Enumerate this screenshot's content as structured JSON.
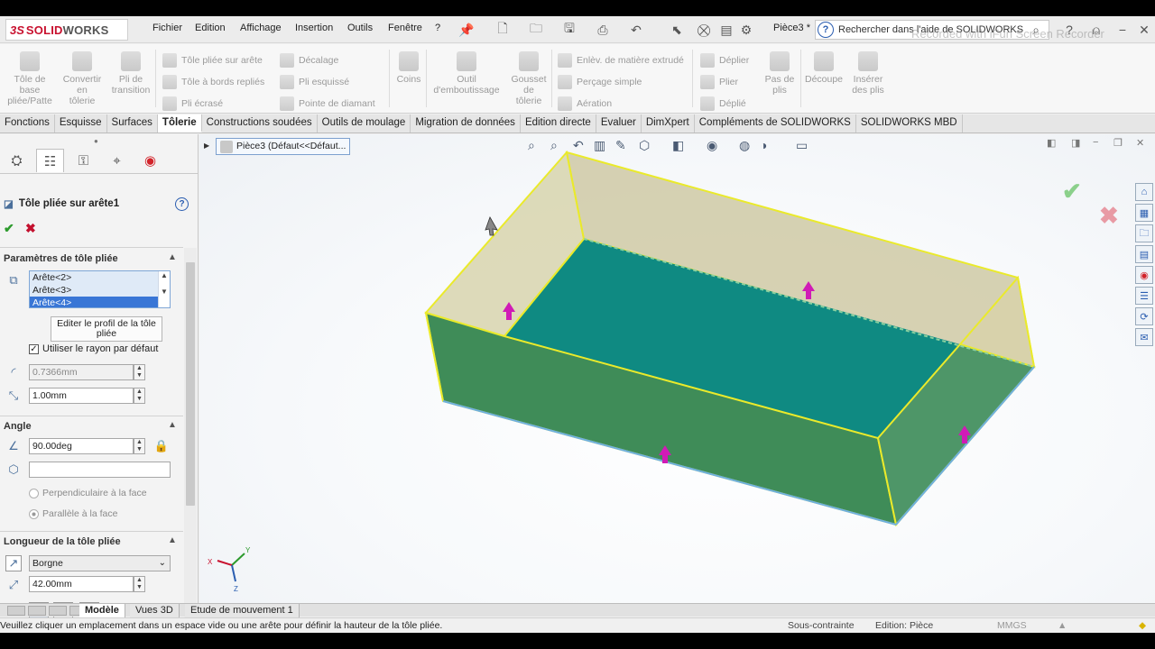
{
  "app": {
    "logo_ds": "3S",
    "logo_brand_a": "SOLID",
    "logo_brand_b": "WORKS",
    "doc_title": "Pièce3 *",
    "search_placeholder": "Rechercher dans l'aide de SOLIDWORKS",
    "watermark": "Recorded with iFun Screen Recorder"
  },
  "menu": [
    "Fichier",
    "Edition",
    "Affichage",
    "Insertion",
    "Outils",
    "Fenêtre",
    "?"
  ],
  "ribbon": {
    "big": [
      {
        "label": "Tôle de\nbase\npliée/Patte"
      },
      {
        "label": "Convertir\nen\ntôlerie"
      },
      {
        "label": "Pli de\ntransition"
      },
      {
        "label": "Coins"
      },
      {
        "label": "Outil\nd'emboutissage"
      },
      {
        "label": "Gousset\nde\ntôlerie"
      },
      {
        "label": "Pas de\nplis"
      },
      {
        "label": "Découpe"
      },
      {
        "label": "Insérer\ndes plis"
      }
    ],
    "small": [
      {
        "label": "Tôle pliée sur arête"
      },
      {
        "label": "Tôle à bords repliés"
      },
      {
        "label": "Pli écrasé"
      },
      {
        "label": "Décalage"
      },
      {
        "label": "Pli esquissé"
      },
      {
        "label": "Pointe de diamant"
      },
      {
        "label": "Enlèv. de matière extrudé"
      },
      {
        "label": "Perçage simple"
      },
      {
        "label": "Aération"
      },
      {
        "label": "Déplier"
      },
      {
        "label": "Plier"
      },
      {
        "label": "Déplié"
      }
    ]
  },
  "tabs": [
    "Fonctions",
    "Esquisse",
    "Surfaces",
    "Tôlerie",
    "Constructions soudées",
    "Outils de moulage",
    "Migration de données",
    "Edition directe",
    "Evaluer",
    "DimXpert",
    "Compléments de SOLIDWORKS",
    "SOLIDWORKS MBD"
  ],
  "active_tab": "Tôlerie",
  "property_manager": {
    "title": "Tôle pliée sur arête1",
    "group1": {
      "title": "Paramètres de tôle pliée",
      "edges": [
        "Arête<2>",
        "Arête<3>",
        "Arête<4>"
      ],
      "edit_profile": "Editer le profil de la tôle pliée",
      "use_default_radius": "Utiliser le rayon par défaut",
      "use_default_radius_checked": true,
      "radius": "0.7366mm",
      "gap": "1.00mm"
    },
    "group2": {
      "title": "Angle",
      "angle": "90.00deg",
      "face_ref": "",
      "perpendicular": "Perpendiculaire à la face",
      "parallel": "Parallèle à la face"
    },
    "group3": {
      "title": "Longueur de la tôle pliée",
      "end_condition": "Borgne",
      "length": "42.00mm"
    }
  },
  "viewport": {
    "tree_label": "Pièce3  (Défaut<<Défaut...",
    "triad": {
      "x": "X",
      "y": "Y",
      "z": "Z"
    }
  },
  "bottom_tabs": [
    "Modèle",
    "Vues 3D",
    "Etude de mouvement 1"
  ],
  "status": {
    "message": "Veuillez cliquer un emplacement dans un espace vide ou une arête pour définir la hauteur de la tôle pliée.",
    "constraint": "Sous-contrainte",
    "editing": "Edition: Pièce",
    "units": "MMGS"
  },
  "colors": {
    "brand_red": "#c8102e",
    "face_teal": "#0f8a82",
    "flange_green": "#3f8c58",
    "flange_tan": "#c8c295",
    "edge_yellow": "#f2f200",
    "handle_magenta": "#d01bb6"
  }
}
